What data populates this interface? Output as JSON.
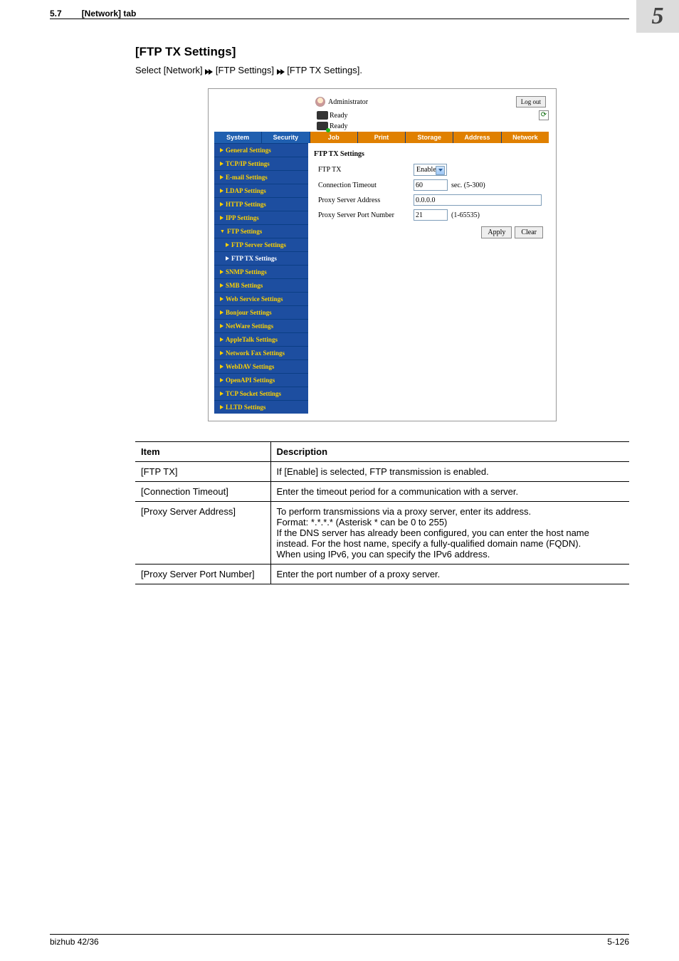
{
  "header": {
    "section_number": "5.7",
    "section_title": "[Network] tab",
    "chapter": "5"
  },
  "page_title": "[FTP TX Settings]",
  "intro": {
    "seg1": "Select [Network] ",
    "seg2": " [FTP Settings] ",
    "seg3": " [FTP TX Settings]."
  },
  "screenshot": {
    "admin_label": "Administrator",
    "logout": "Log out",
    "ready1": "Ready",
    "ready2": "Ready",
    "tabs": [
      "System",
      "Security",
      "Job",
      "Print",
      "Storage",
      "Address",
      "Network"
    ],
    "sidebar": {
      "general": "General Settings",
      "tcpip": "TCP/IP Settings",
      "email": "E-mail Settings",
      "ldap": "LDAP Settings",
      "http": "HTTP Settings",
      "ipp": "IPP Settings",
      "ftp": "FTP Settings",
      "ftp_server": "FTP Server Settings",
      "ftp_tx": "FTP TX Settings",
      "snmp": "SNMP Settings",
      "smb": "SMB Settings",
      "websvc": "Web Service Settings",
      "bonjour": "Bonjour Settings",
      "netware": "NetWare Settings",
      "appletalk": "AppleTalk Settings",
      "netfax": "Network Fax Settings",
      "webdav": "WebDAV Settings",
      "openapi": "OpenAPI Settings",
      "tcpsocket": "TCP Socket Settings",
      "lltd": "LLTD Settings"
    },
    "form": {
      "panel_title": "FTP TX Settings",
      "rows": {
        "ftp_tx_label": "FTP TX",
        "ftp_tx_value": "Enable",
        "conn_timeout_label": "Connection Timeout",
        "conn_timeout_value": "60",
        "conn_timeout_hint": "sec. (5-300)",
        "proxy_addr_label": "Proxy Server Address",
        "proxy_addr_value": "0.0.0.0",
        "proxy_port_label": "Proxy Server Port Number",
        "proxy_port_value": "21",
        "proxy_port_hint": "(1-65535)"
      },
      "apply": "Apply",
      "clear": "Clear"
    }
  },
  "table": {
    "head_item": "Item",
    "head_desc": "Description",
    "rows": [
      {
        "item": "[FTP TX]",
        "desc": "If [Enable] is selected, FTP transmission is enabled."
      },
      {
        "item": "[Connection Timeout]",
        "desc": "Enter the timeout period for a communication with a server."
      },
      {
        "item": "[Proxy Server Address]",
        "desc": "To perform transmissions via a proxy server, enter its address.\nFormat: *.*.*.* (Asterisk * can be 0 to 255)\nIf the DNS server has already been configured, you can enter the host name instead. For the host name, specify a fully-qualified domain name (FQDN).\nWhen using IPv6, you can specify the IPv6 address."
      },
      {
        "item": "[Proxy Server Port Number]",
        "desc": "Enter the port number of a proxy server."
      }
    ]
  },
  "footer": {
    "left": "bizhub 42/36",
    "right": "5-126"
  }
}
